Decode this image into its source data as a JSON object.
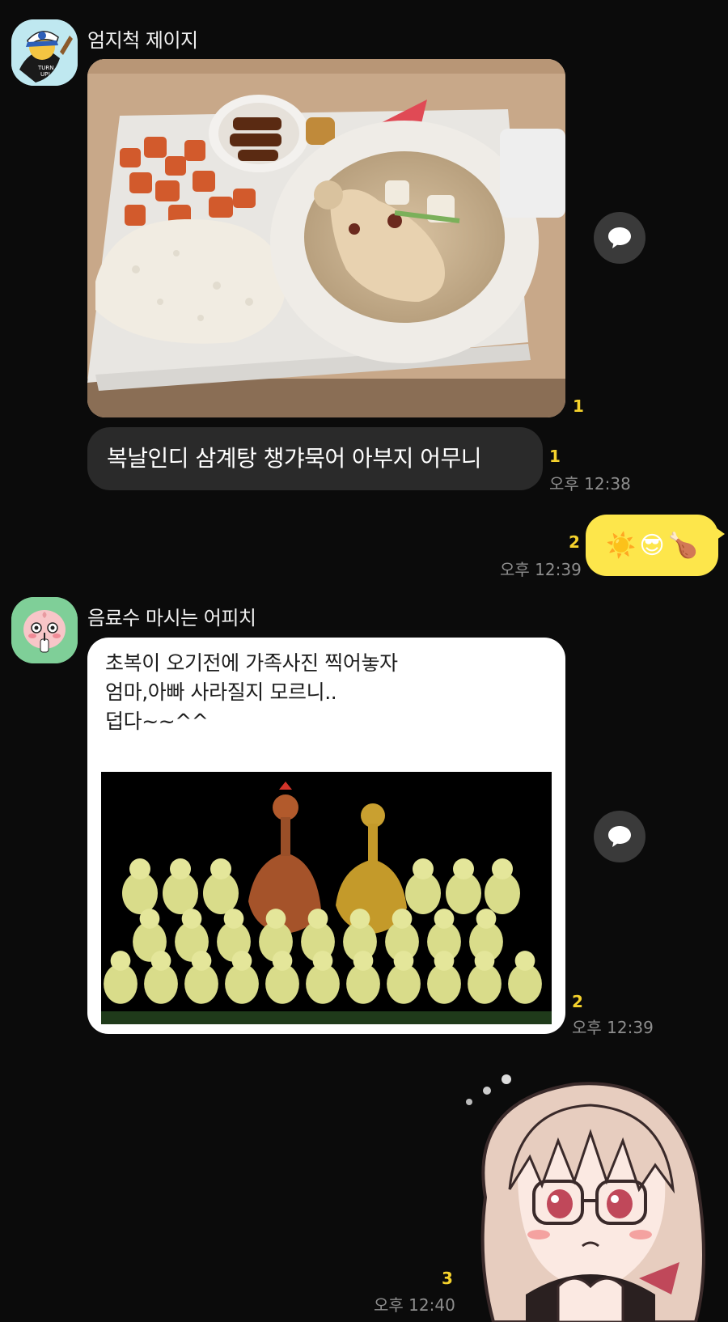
{
  "messages": [
    {
      "sender": "엄지척 제이지",
      "photo_unread": "1",
      "text": "복날인디 삼계탕 챙갸묵어 아부지 어무니",
      "text_unread": "1",
      "time": "오후 12:38"
    },
    {
      "mine": true,
      "emoji": [
        "☀️",
        "😎",
        "🍗"
      ],
      "unread": "2",
      "time": "오후 12:39"
    },
    {
      "sender": "음료수 마시는 어피치",
      "lines": [
        "초복이 오기전에 가족사진 찍어놓자",
        "엄마,아빠 사라질지 모르니..",
        "덥다~~^^"
      ],
      "unread": "2",
      "time": "오후 12:39"
    },
    {
      "mine": true,
      "sticker": "anime-girl-with-glasses-sticker",
      "unread": "3",
      "time": "오후 12:40"
    }
  ],
  "icons": {
    "share": "speech-bubble-icon"
  },
  "colors": {
    "background": "#0b0b0b",
    "my_bubble": "#fde64b",
    "other_bubble_dark": "#2a2a2a",
    "unread_count": "#f5d22c",
    "time": "#8e8e8e"
  }
}
